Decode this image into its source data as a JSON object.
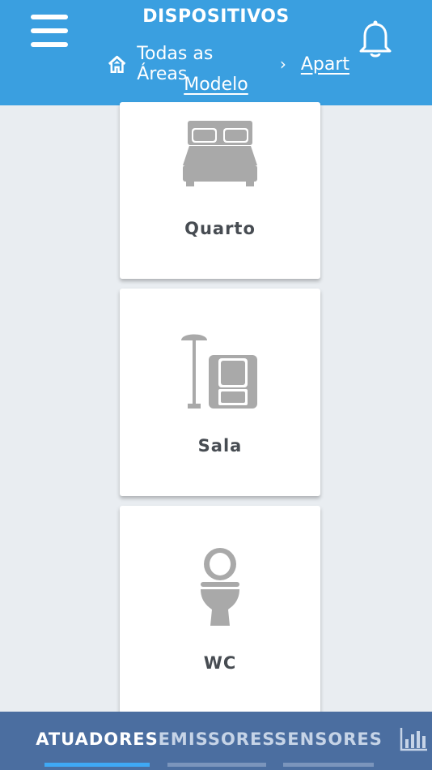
{
  "header": {
    "title": "DISPOSITIVOS",
    "breadcrumb": {
      "home_label": "Todas as Áreas",
      "separator": "›",
      "current_part1": "Apart",
      "current_part2": "Modelo"
    },
    "bg_color": "#3a9fe0"
  },
  "areas": [
    {
      "label": "Quarto",
      "icon": "bed-icon"
    },
    {
      "label": "Sala",
      "icon": "living-room-icon"
    },
    {
      "label": "WC",
      "icon": "toilet-icon"
    }
  ],
  "tabs": [
    {
      "label": "ATUADORES",
      "active": true
    },
    {
      "label": "EMISSORES",
      "active": false
    },
    {
      "label": "SENSORES",
      "active": false
    }
  ],
  "tab_extra_icon": "bar-chart-icon",
  "colors": {
    "accent": "#3fa9f5",
    "tabbar": "#4b6ea0",
    "icon_gray": "#a9a9a9"
  }
}
